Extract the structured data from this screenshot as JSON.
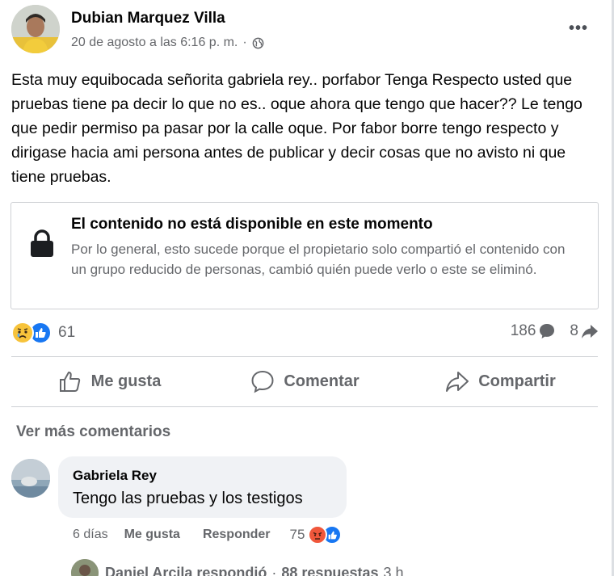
{
  "post": {
    "author": "Dubian Marquez Villa",
    "timestamp": "20 de agosto a las 6:16 p. m.",
    "separator": "·",
    "audience_icon": "globe-icon",
    "more_icon": "•••",
    "text": "Esta muy equibocada señorita gabriela rey.. porfabor Tenga Respecto usted que pruebas tiene pa decir lo que no es.. oque ahora que tengo que hacer?? Le tengo que pedir permiso pa pasar por la calle oque. Por fabor borre tengo respecto y dirigase hacia ami persona antes de publicar y decir cosas que no avisto ni que tiene pruebas."
  },
  "unavailable": {
    "title": "El contenido no está disponible en este momento",
    "body": "Por lo general, esto sucede porque el propietario solo compartió el contenido con un grupo reducido de personas, cambió quién puede verlo o este se eliminó."
  },
  "reactions": {
    "icons": [
      "sad-reaction-icon",
      "like-reaction-icon"
    ],
    "count": "61",
    "comments_count": "186",
    "shares_count": "8"
  },
  "actions": {
    "like": "Me gusta",
    "comment": "Comentar",
    "share": "Compartir"
  },
  "comments": {
    "view_more": "Ver más comentarios",
    "items": [
      {
        "author": "Gabriela Rey",
        "text": "Tengo las pruebas y los testigos",
        "time": "6 días",
        "like_label": "Me gusta",
        "reply_label": "Responder",
        "reaction_count": "75",
        "reaction_icons": [
          "angry-reaction-icon",
          "like-reaction-icon"
        ]
      }
    ],
    "reply_summary": {
      "who": "Daniel Arcila respondió",
      "sep": "·",
      "count": "88 respuestas",
      "time": "3 h"
    }
  },
  "colors": {
    "primary_text": "#050505",
    "secondary_text": "#65676b",
    "like_blue": "#1877f2",
    "bubble_bg": "#f0f2f5",
    "divider": "#ced0d4"
  }
}
